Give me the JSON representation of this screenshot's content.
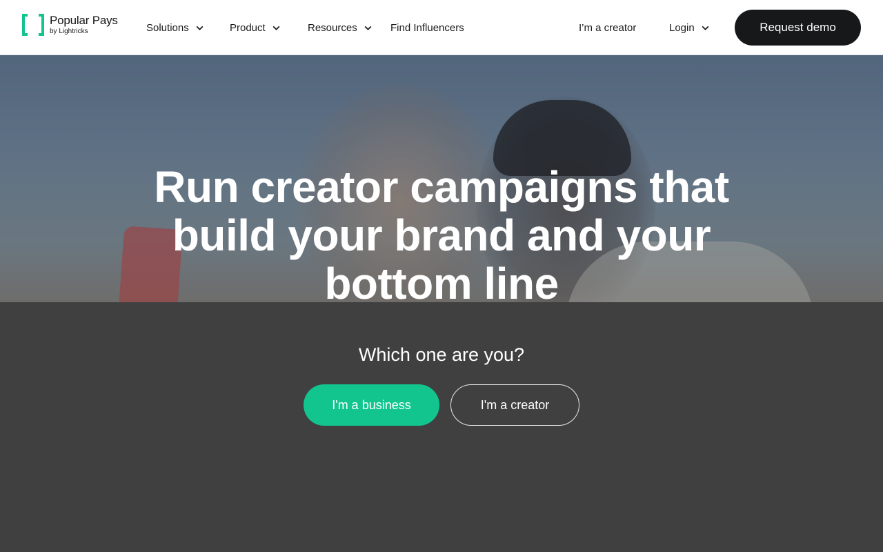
{
  "brand": {
    "name": "Popular Pays",
    "sub": "by Lightricks",
    "accent_color": "#12c58f",
    "dark_color": "#17181a"
  },
  "nav": {
    "items": [
      {
        "label": "Solutions",
        "has_dropdown": true
      },
      {
        "label": "Product",
        "has_dropdown": true
      },
      {
        "label": "Resources",
        "has_dropdown": true
      },
      {
        "label": "Find Influencers",
        "has_dropdown": false
      }
    ],
    "creator_link": "I’m a creator",
    "login": {
      "label": "Login",
      "has_dropdown": true
    },
    "cta": "Request demo"
  },
  "hero": {
    "title": "Run creator campaigns that build your brand and your bottom line",
    "question": "Which one are you?",
    "business_button": "I'm a business",
    "creator_button": "I'm a creator"
  },
  "icons": [
    "logo-bracket-icon",
    "chevron-down-icon"
  ]
}
